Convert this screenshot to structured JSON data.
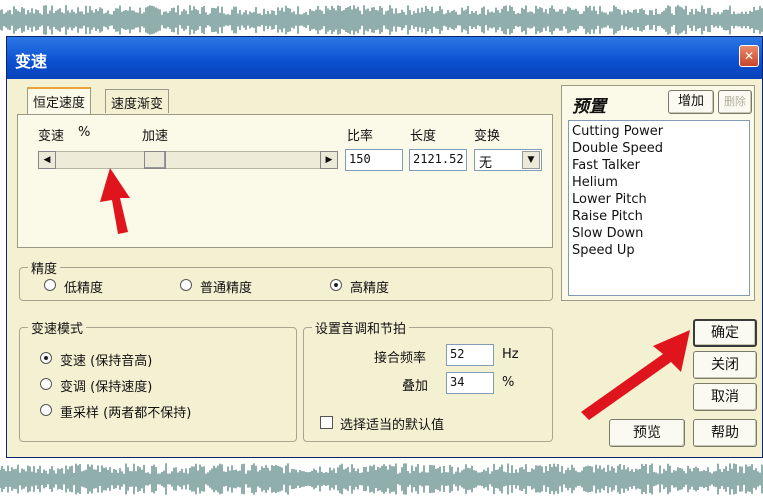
{
  "window": {
    "title": "变速",
    "close_glyph": "✕"
  },
  "tabs": [
    {
      "label": "恒定速度",
      "active": true
    },
    {
      "label": "速度渐变",
      "active": false
    }
  ],
  "speed": {
    "left_label": "变速",
    "percent_symbol": "%",
    "right_label": "加速",
    "ratio_label": "比率",
    "ratio_value": "150",
    "length_label": "长度",
    "length_value": "2121.52",
    "transform_label": "变换",
    "transform_value": "无"
  },
  "precision": {
    "title": "精度",
    "options": [
      {
        "label": "低精度",
        "checked": false
      },
      {
        "label": "普通精度",
        "checked": false
      },
      {
        "label": "高精度",
        "checked": true
      }
    ]
  },
  "mode": {
    "title": "变速模式",
    "options": [
      {
        "label": "变速 (保持音高)",
        "checked": true
      },
      {
        "label": "变调 (保持速度)",
        "checked": false
      },
      {
        "label": "重采样 (两者都不保持)",
        "checked": false
      }
    ]
  },
  "pitch": {
    "title": "设置音调和节拍",
    "splice_label": "接合频率",
    "splice_value": "52",
    "splice_unit": "Hz",
    "overlap_label": "叠加",
    "overlap_value": "34",
    "overlap_unit": "%",
    "default_label": "选择适当的默认值"
  },
  "presets": {
    "title": "预置",
    "add_label": "增加",
    "delete_label": "删除",
    "items": [
      "Cutting Power",
      "Double Speed",
      "Fast Talker",
      "Helium",
      "Lower Pitch",
      "Raise Pitch",
      "Slow Down",
      "Speed Up"
    ]
  },
  "buttons": {
    "ok": "确定",
    "close": "关闭",
    "cancel": "取消",
    "preview": "预览",
    "help": "帮助"
  },
  "colors": {
    "dialog_bg": "#f4f0d2",
    "title_bar": "#0b4fd0",
    "annotation_arrow": "#e0141c"
  }
}
